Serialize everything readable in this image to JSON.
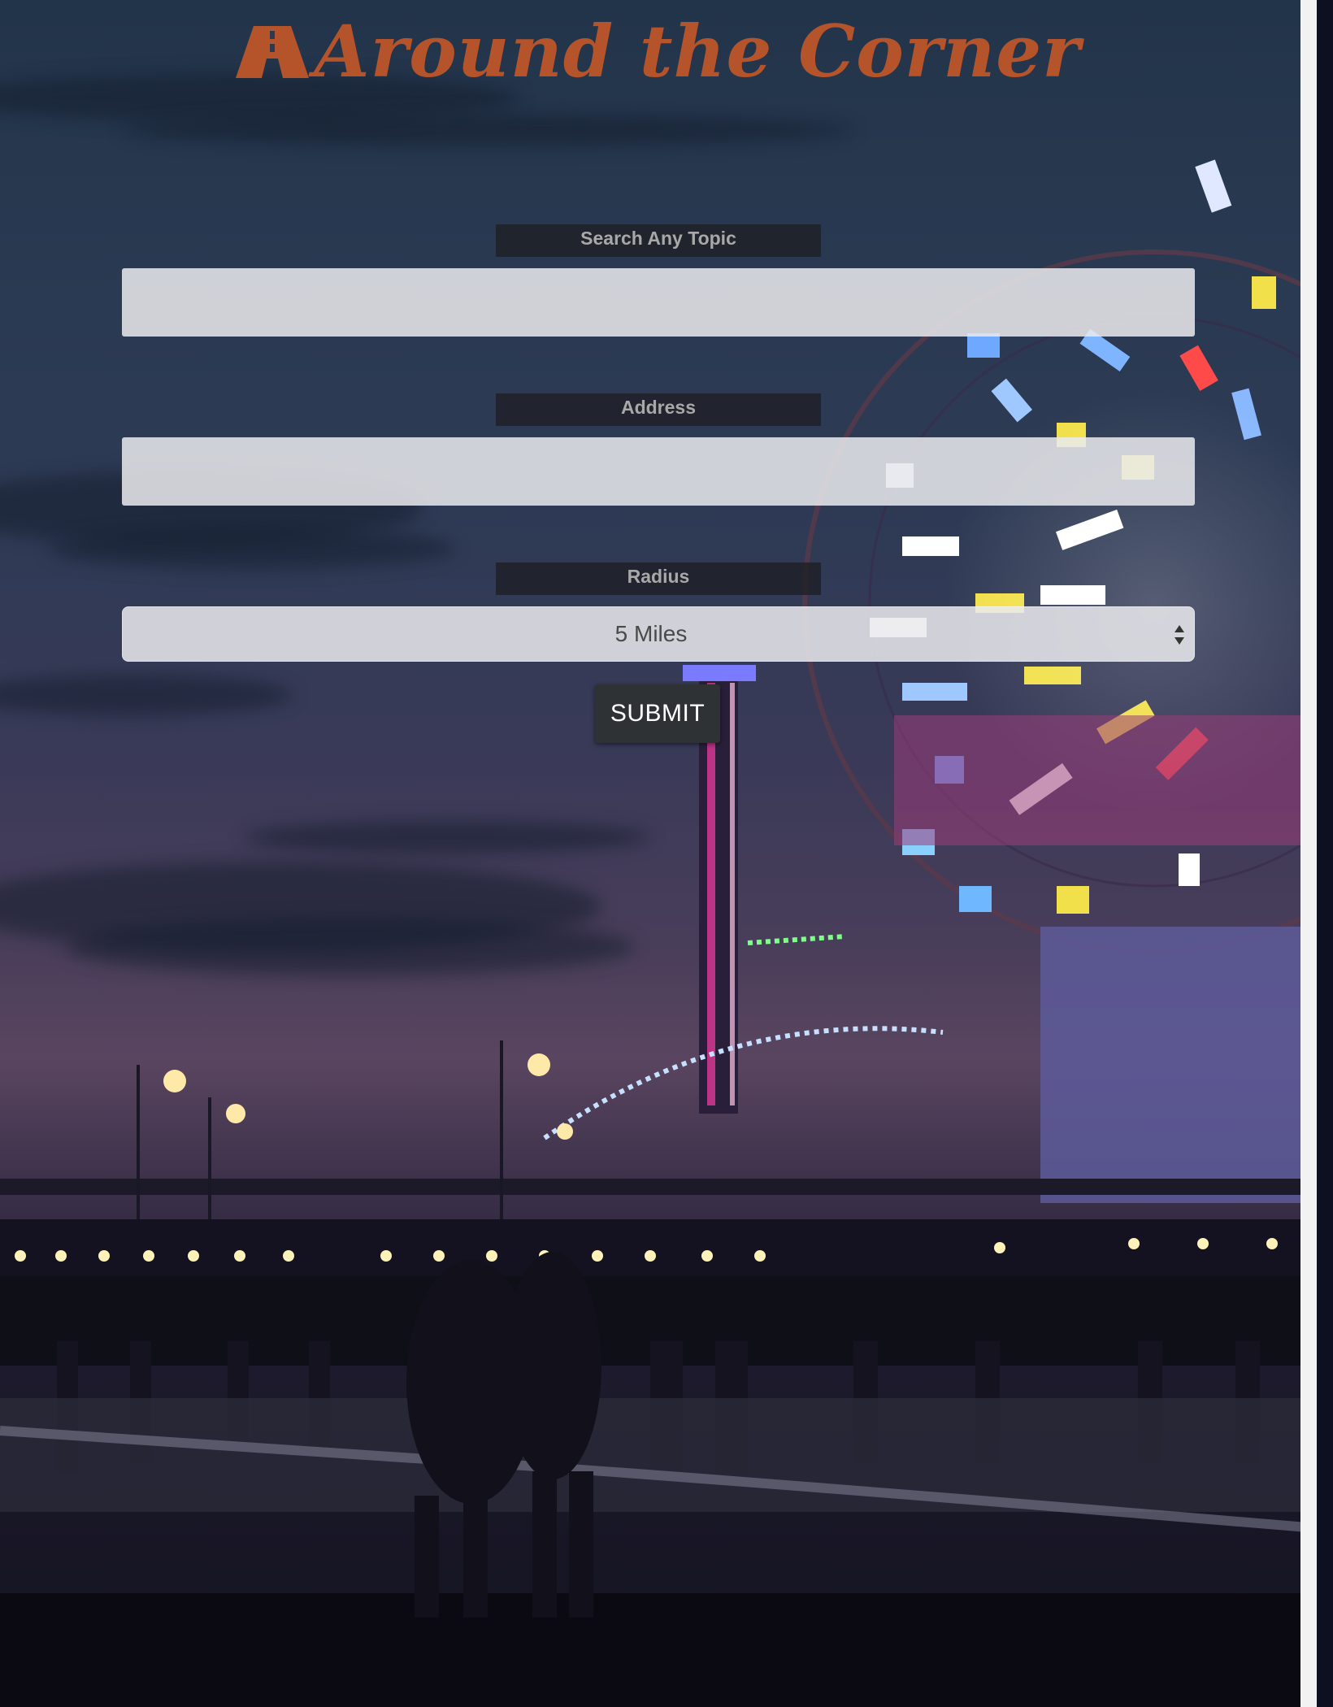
{
  "header": {
    "title": "Around the Corner",
    "logo_icon": "road-icon",
    "color": "#b5542a"
  },
  "form": {
    "topic": {
      "label": "Search Any Topic",
      "value": "",
      "placeholder": ""
    },
    "address": {
      "label": "Address",
      "value": "",
      "placeholder": ""
    },
    "radius": {
      "label": "Radius",
      "selected": "5 Miles"
    },
    "submit_label": "SUBMIT"
  },
  "background": {
    "description_icon": "pier-ferris-wheel-photo"
  }
}
